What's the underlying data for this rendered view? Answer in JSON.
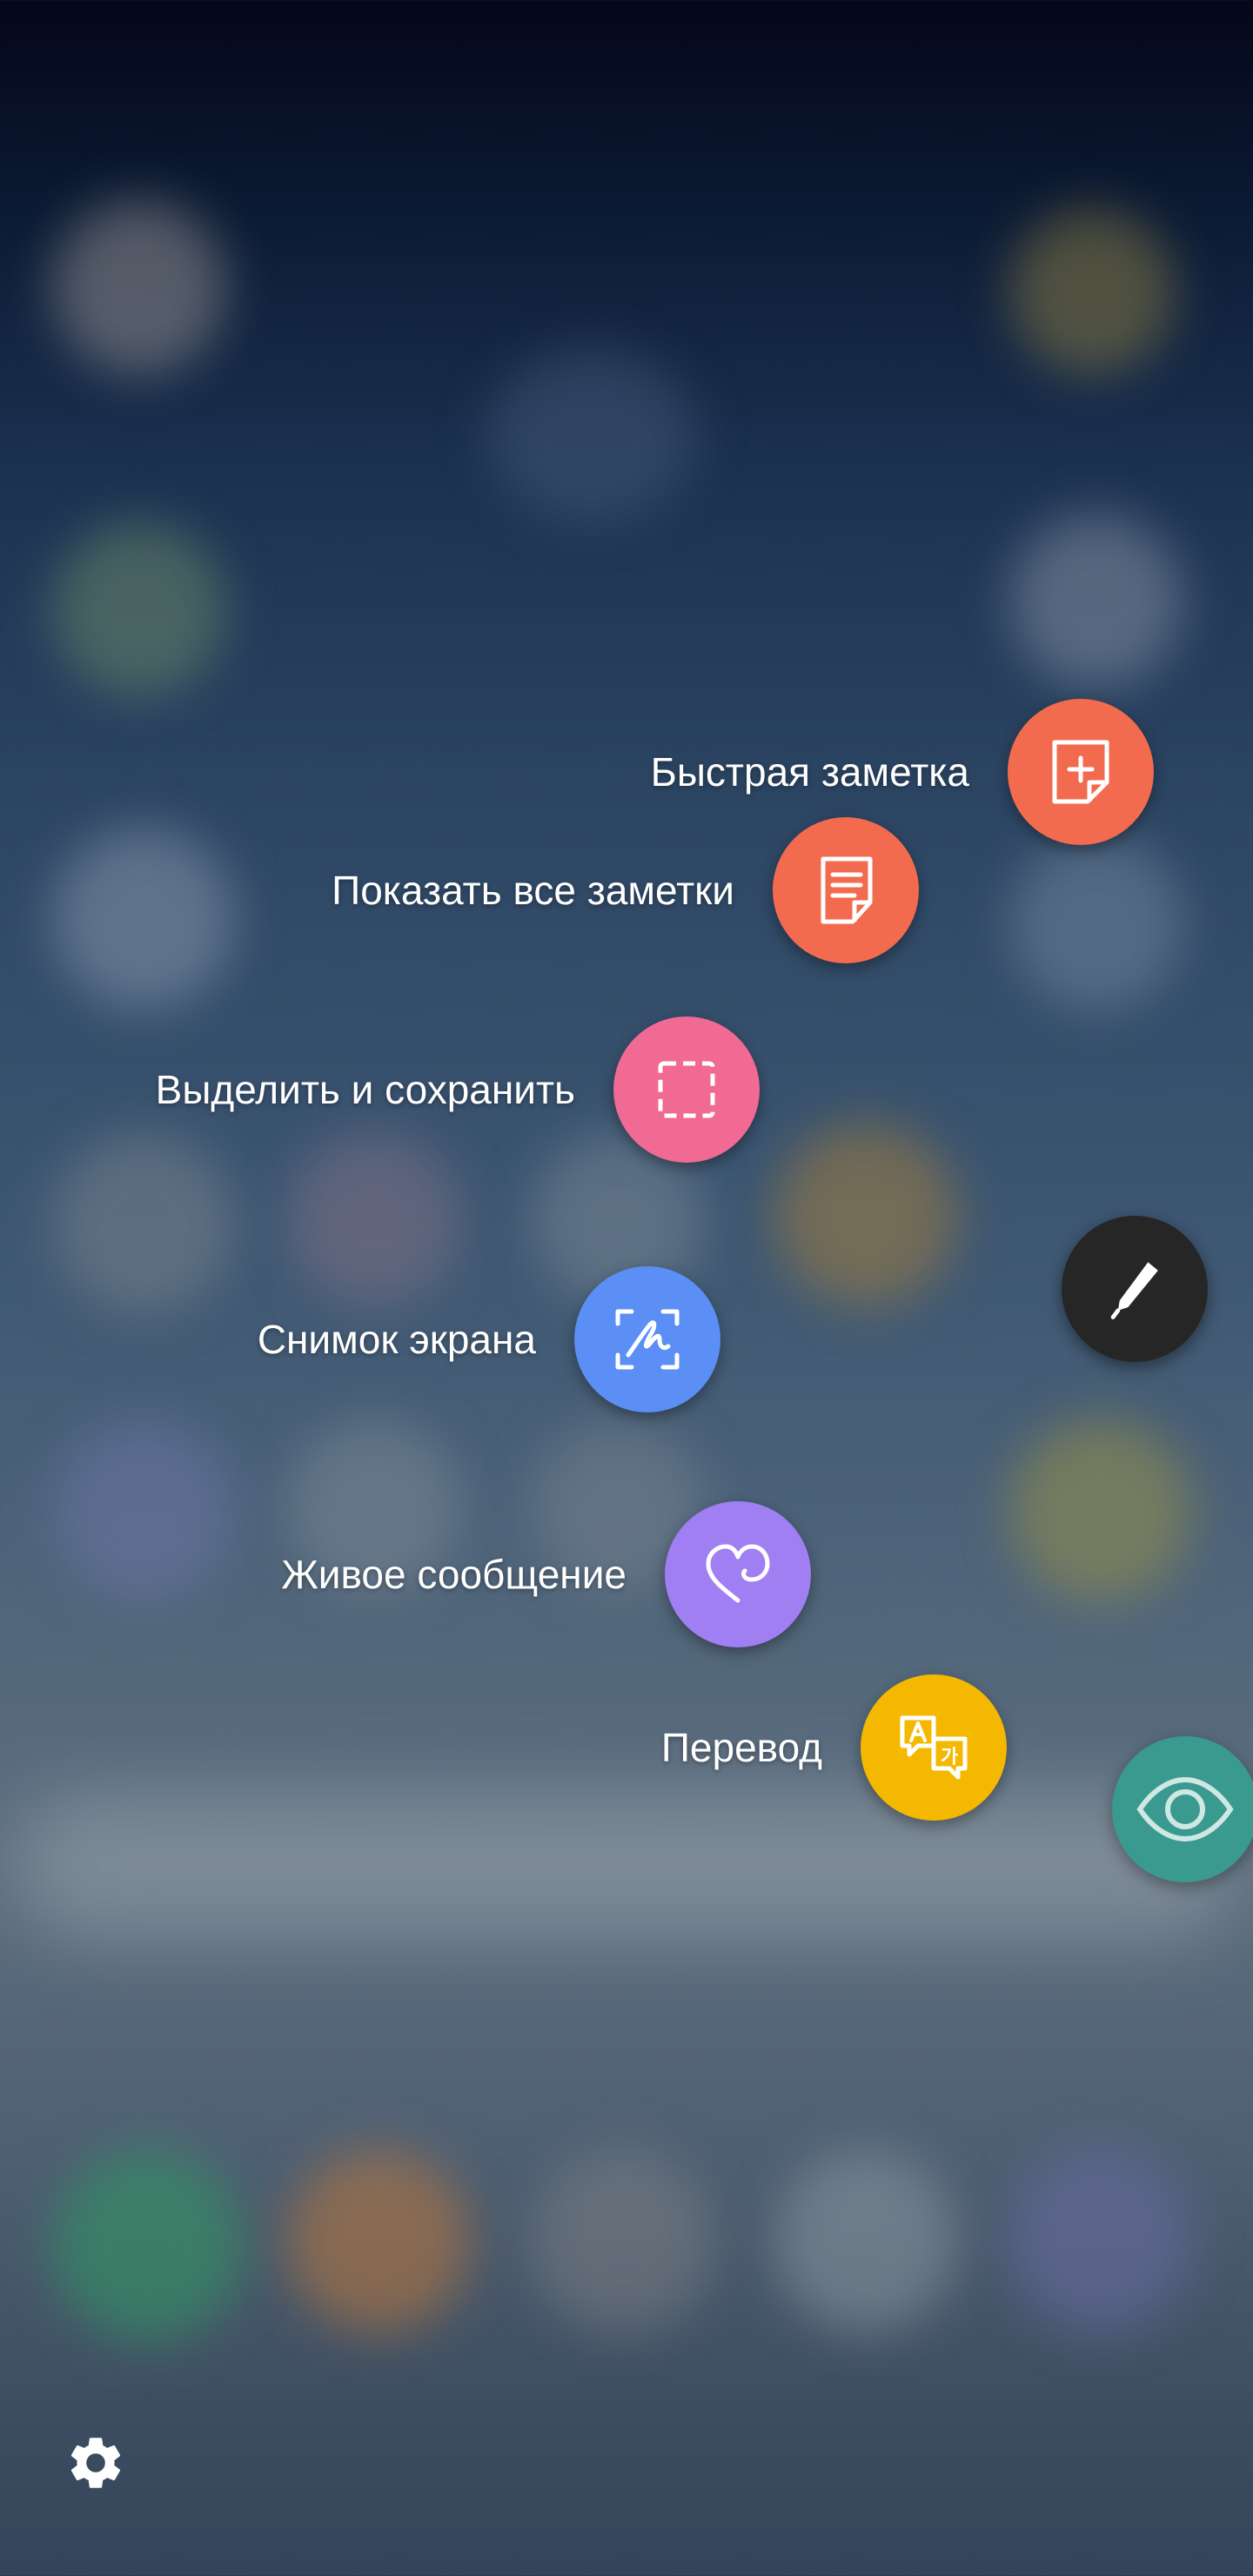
{
  "actions": [
    {
      "id": "quick-note",
      "label": "Быстрая заметка",
      "color": "#f26b4f",
      "icon": "note-add-icon"
    },
    {
      "id": "show-all-notes",
      "label": "Показать все заметки",
      "color": "#f26b4f",
      "icon": "notes-list-icon"
    },
    {
      "id": "select-save",
      "label": "Выделить и сохранить",
      "color": "#f06a93",
      "icon": "selection-icon"
    },
    {
      "id": "screenshot",
      "label": "Снимок экрана",
      "color": "#5b8ff5",
      "icon": "screen-write-icon"
    },
    {
      "id": "live-message",
      "label": "Живое сообщение",
      "color": "#a07ff2",
      "icon": "heart-icon"
    },
    {
      "id": "translate",
      "label": "Перевод",
      "color": "#f5b800",
      "icon": "translate-icon"
    }
  ],
  "pen_button": {
    "icon": "pen-icon",
    "color": "#262626"
  },
  "eye_button": {
    "icon": "eye-icon",
    "color": "#3a9a8f"
  },
  "settings": {
    "icon": "gear-icon"
  }
}
